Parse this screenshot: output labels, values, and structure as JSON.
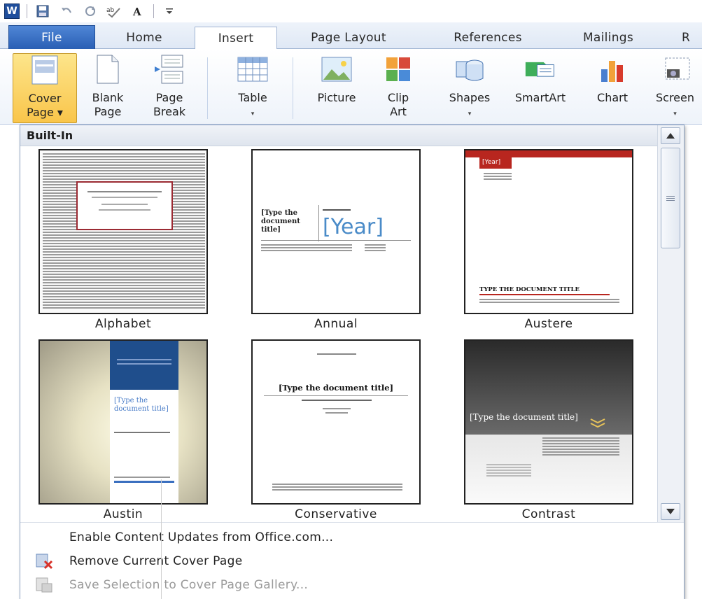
{
  "quick_access": {
    "app_icon_letter": "W",
    "buttons": [
      "save-icon",
      "undo-icon",
      "redo-icon",
      "spelling-icon",
      "font-icon",
      "customize-icon"
    ]
  },
  "tabs": [
    {
      "label": "File"
    },
    {
      "label": "Home"
    },
    {
      "label": "Insert"
    },
    {
      "label": "Page Layout"
    },
    {
      "label": "References"
    },
    {
      "label": "Mailings"
    },
    {
      "label": "R"
    }
  ],
  "ribbon": {
    "cover_page": {
      "line1": "Cover",
      "line2": "Page ▾"
    },
    "blank_page": {
      "line1": "Blank",
      "line2": "Page"
    },
    "page_break": {
      "line1": "Page",
      "line2": "Break"
    },
    "table": {
      "line1": "Table",
      "line2": "▾"
    },
    "picture": {
      "line1": "Picture"
    },
    "clip_art": {
      "line1": "Clip",
      "line2": "Art"
    },
    "shapes": {
      "line1": "Shapes",
      "line2": "▾"
    },
    "smartart": {
      "line1": "SmartArt"
    },
    "chart": {
      "line1": "Chart"
    },
    "screenshot": {
      "line1": "Screen",
      "line2": "▾"
    }
  },
  "gallery": {
    "header": "Built-In",
    "tiles": [
      {
        "name": "Alphabet"
      },
      {
        "name": "Annual",
        "year": "[Year]",
        "title": "[Type the document title]"
      },
      {
        "name": "Austere",
        "year": "[Year]",
        "title": "TYPE THE DOCUMENT TITLE"
      },
      {
        "name": "Austin",
        "title": "[Type the document title]"
      },
      {
        "name": "Conservative",
        "title": "[Type the document title]"
      },
      {
        "name": "Contrast",
        "title": "[Type the document title]"
      }
    ]
  },
  "menu": {
    "enable_updates": "Enable Content Updates from Office.com...",
    "remove_cover": "Remove Current Cover Page",
    "save_selection": "Save Selection to Cover Page Gallery..."
  },
  "colors": {
    "file_tab": "#2a5fb4",
    "pressed_button": "#f9c54a",
    "austere_red": "#b8261f",
    "austin_blue": "#1f4e8c",
    "annual_blue": "#4a8bc8"
  }
}
